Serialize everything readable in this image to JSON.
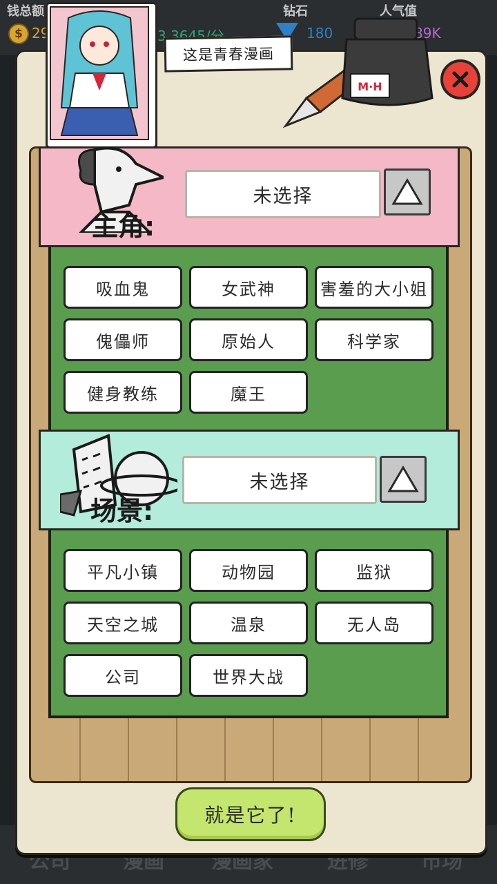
{
  "hud": {
    "money_label": "钱总额",
    "money_value": "29",
    "rate_value": "3.3645/分",
    "diamond_label": "钻石",
    "diamond_value": "180",
    "popularity_label": "人气值",
    "popularity_value": "89K"
  },
  "modal": {
    "title": "这是青春漫画",
    "ink_label": "M·H",
    "protagonist": {
      "label": "主角:",
      "selected": "未选择",
      "options": [
        "吸血鬼",
        "女武神",
        "害羞的大小姐",
        "傀儡师",
        "原始人",
        "科学家",
        "健身教练",
        "魔王"
      ]
    },
    "scene": {
      "label": "场景:",
      "selected": "未选择",
      "options": [
        "平凡小镇",
        "动物园",
        "监狱",
        "天空之城",
        "温泉",
        "无人岛",
        "公司",
        "世界大战"
      ]
    },
    "confirm_label": "就是它了!"
  },
  "bottom_nav": [
    "公司",
    "漫画",
    "漫画家",
    "进修",
    "市场"
  ],
  "colors": {
    "protagonist_header": "#f5b8c7",
    "scene_header": "#b4ecdc",
    "option_area": "#5a9d4f",
    "confirm_button": "#c4e66e",
    "close_button": "#e8413a"
  }
}
